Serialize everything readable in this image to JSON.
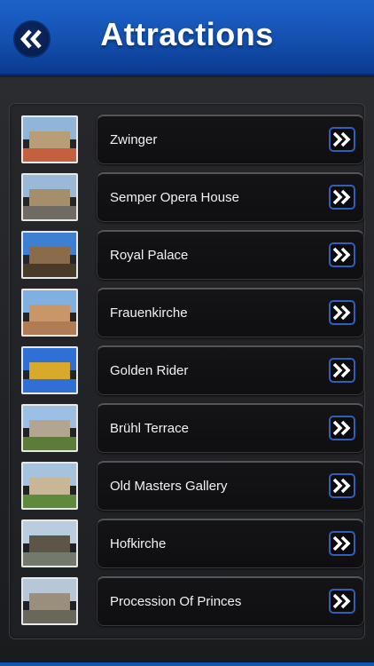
{
  "header": {
    "title": "Attractions",
    "back_icon": "double-chevron-left-icon",
    "color": "#1a5cc4"
  },
  "attractions": [
    {
      "label": "Zwinger",
      "thumb": {
        "sky": "#8fb6d8",
        "bldg": "#b99d77",
        "ground": "#c2603f"
      }
    },
    {
      "label": "Semper Opera House",
      "thumb": {
        "sky": "#9ab9d9",
        "bldg": "#a58e6a",
        "ground": "#6f6a62"
      }
    },
    {
      "label": "Royal Palace",
      "thumb": {
        "sky": "#3d7fd0",
        "bldg": "#8a6b4a",
        "ground": "#4a3a2a"
      }
    },
    {
      "label": "Frauenkirche",
      "thumb": {
        "sky": "#7fb0e2",
        "bldg": "#c99668",
        "ground": "#b07b55"
      }
    },
    {
      "label": "Golden Rider",
      "thumb": {
        "sky": "#2f6fd6",
        "bldg": "#d9a92c",
        "ground": "#2f6fd6"
      }
    },
    {
      "label": "Brühl Terrace",
      "thumb": {
        "sky": "#9cc0e4",
        "bldg": "#b3a58f",
        "ground": "#5d7c3c"
      }
    },
    {
      "label": "Old Masters Gallery",
      "thumb": {
        "sky": "#a6c2dc",
        "bldg": "#c8b696",
        "ground": "#5d8a3b"
      }
    },
    {
      "label": "Hofkirche",
      "thumb": {
        "sky": "#b9cde0",
        "bldg": "#5e5448",
        "ground": "#74796d"
      }
    },
    {
      "label": "Procession Of Princes",
      "thumb": {
        "sky": "#b6c7d8",
        "bldg": "#9a8f7c",
        "ground": "#6a6658"
      }
    }
  ],
  "row_arrow_icon": "double-chevron-right-icon",
  "accent": "#2f5fb8"
}
